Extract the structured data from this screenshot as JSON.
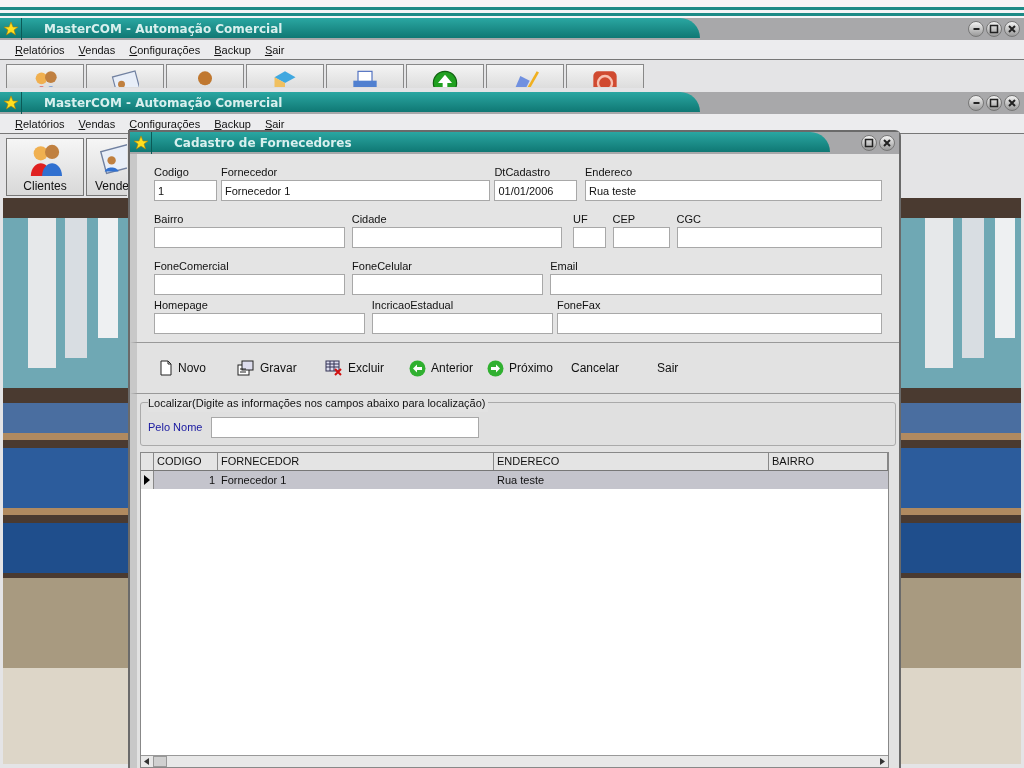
{
  "back_window": {
    "title": "MasterCOM - Automação Comercial",
    "menu": [
      "Relatórios",
      "Vendas",
      "Configurações",
      "Backup",
      "Sair"
    ]
  },
  "front_window": {
    "title": "MasterCOM - Automação Comercial",
    "menu": [
      "Relatórios",
      "Vendas",
      "Configurações",
      "Backup",
      "Sair"
    ],
    "toolbar": [
      {
        "label": "Clientes",
        "kind": "people"
      },
      {
        "label": "Vende",
        "kind": "card"
      }
    ]
  },
  "dialog": {
    "title": "Cadastro de Fornecedores",
    "field_rows": [
      [
        {
          "label": "Codigo",
          "value": "1"
        },
        {
          "label": "Fornecedor",
          "value": "Fornecedor 1"
        },
        {
          "label": "DtCadastro",
          "value": "01/01/2006"
        },
        {
          "label": "Endereco",
          "value": "Rua teste"
        }
      ],
      [
        {
          "label": "Bairro"
        },
        {
          "label": "Cidade"
        },
        {
          "label": "UF"
        },
        {
          "label": "CEP"
        },
        {
          "label": "CGC"
        }
      ],
      [
        {
          "label": "FoneComercial"
        },
        {
          "label": "FoneCelular"
        },
        {
          "label": "Email"
        }
      ],
      [
        {
          "label": "Homepage"
        },
        {
          "label": "IncricaoEstadual"
        },
        {
          "label": "FoneFax"
        }
      ]
    ],
    "buttons": [
      {
        "label": "Novo",
        "kind": "new"
      },
      {
        "label": "Gravar",
        "kind": "save"
      },
      {
        "label": "Excluir",
        "kind": "delete"
      },
      {
        "label": "Anterior",
        "kind": "prev"
      },
      {
        "label": "Próximo",
        "kind": "next"
      },
      {
        "label": "Cancelar",
        "kind": "plain"
      },
      {
        "label": "Sair",
        "kind": "plain"
      }
    ],
    "search": {
      "legend": "Localizar(Digite as informações nos campos abaixo para localização)",
      "label": "Pelo Nome"
    },
    "grid": {
      "columns": [
        "CODIGO",
        "FORNECEDOR",
        "ENDERECO",
        "BAIRRO"
      ],
      "rows": [
        {
          "cells": [
            "1",
            "Fornecedor 1",
            "Rua teste"
          ],
          "selected": true
        }
      ]
    }
  }
}
